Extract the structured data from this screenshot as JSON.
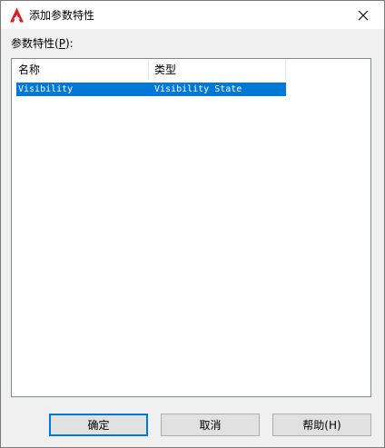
{
  "window": {
    "title": "添加参数特性",
    "icon": "autocad-a-icon",
    "accent": "#d4202c"
  },
  "list_label": {
    "prefix": "参数特性(",
    "mnemonic": "P",
    "suffix": "):"
  },
  "table": {
    "columns": [
      "名称",
      "类型"
    ],
    "rows": [
      {
        "name": "Visibility",
        "type": "Visibility State",
        "selected": true
      }
    ],
    "selection_color": "#0078d7"
  },
  "buttons": {
    "ok": "确定",
    "cancel": "取消",
    "help": "帮助(H)"
  }
}
